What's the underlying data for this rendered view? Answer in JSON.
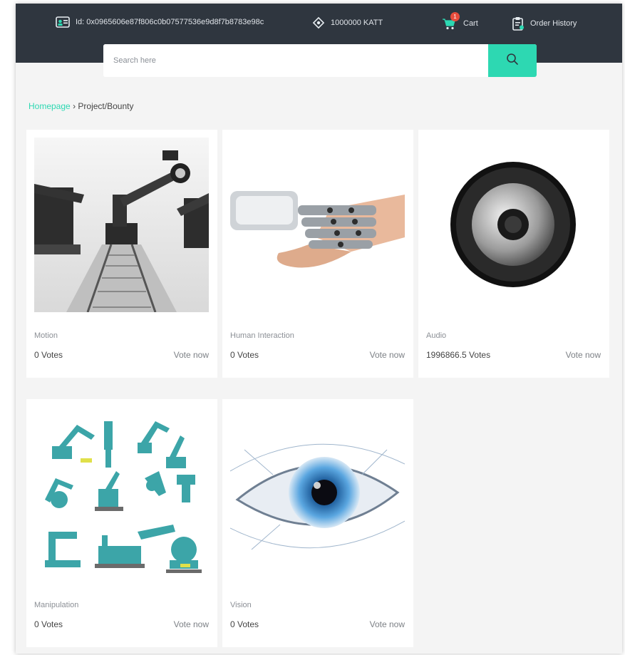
{
  "header": {
    "account_id": "Id: 0x0965606e87f806c0b07577536e9d8f7b8783e98c",
    "balance": "1000000 KATT",
    "cart_label": "Cart",
    "cart_count": "1",
    "order_history_label": "Order History"
  },
  "search": {
    "placeholder": "Search here"
  },
  "breadcrumb": {
    "home": "Homepage",
    "separator": "›",
    "current": "Project/Bounty"
  },
  "colors": {
    "accent": "#2dd8b2",
    "header_bg": "#2f363f",
    "badge": "#e74c3c"
  },
  "cards": [
    {
      "category": "Motion",
      "votes": "0 Votes",
      "vote_label": "Vote now",
      "image_icon": "camera-crane-robots-image"
    },
    {
      "category": "Human Interaction",
      "votes": "0 Votes",
      "vote_label": "Vote now",
      "image_icon": "robot-human-handshake-image"
    },
    {
      "category": "Audio",
      "votes": "1996866.5 Votes",
      "vote_label": "Vote now",
      "image_icon": "speaker-image"
    },
    {
      "category": "Manipulation",
      "votes": "0 Votes",
      "vote_label": "Vote now",
      "image_icon": "robot-arms-collection-image"
    },
    {
      "category": "Vision",
      "votes": "0 Votes",
      "vote_label": "Vote now",
      "image_icon": "eye-image"
    }
  ]
}
